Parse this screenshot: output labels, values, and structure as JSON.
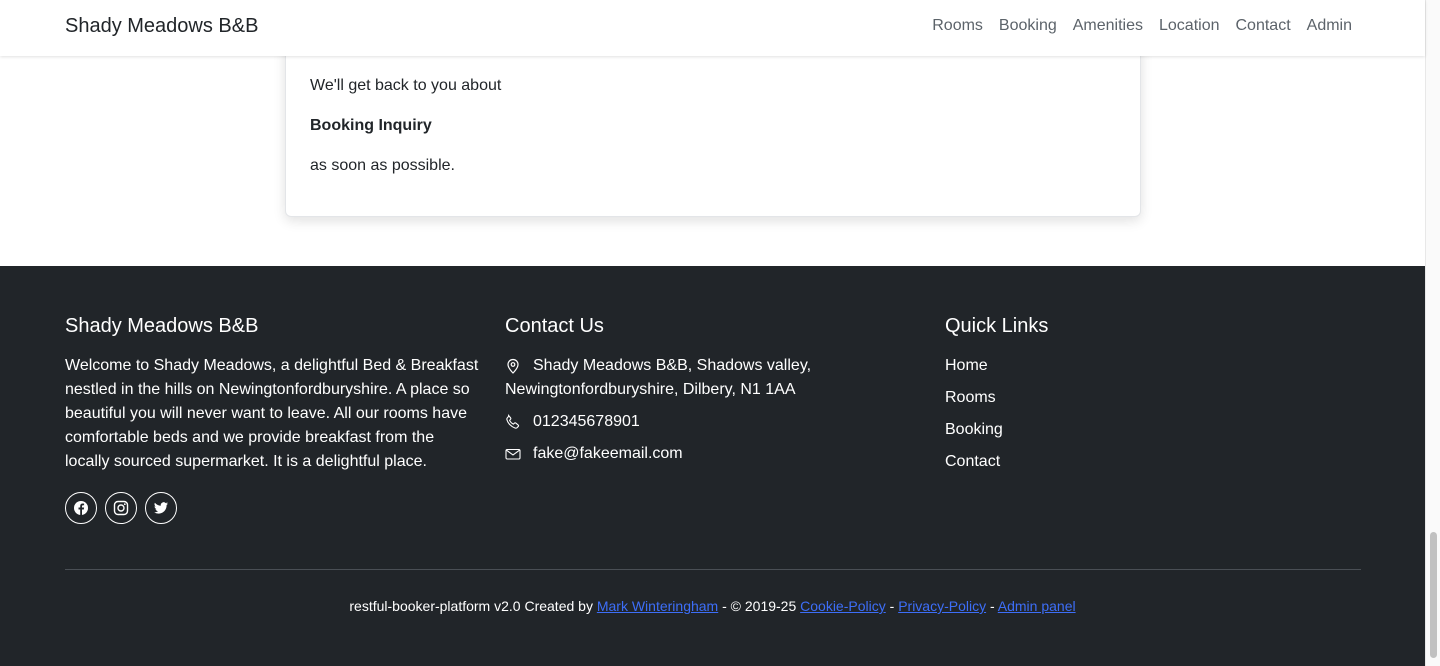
{
  "navbar": {
    "brand": "Shady Meadows B&B",
    "links": [
      "Rooms",
      "Booking",
      "Amenities",
      "Location",
      "Contact",
      "Admin"
    ]
  },
  "card": {
    "line1": "We'll get back to you about",
    "subject": "Booking Inquiry",
    "line3": "as soon as possible."
  },
  "footer": {
    "about": {
      "title": "Shady Meadows B&B",
      "text": "Welcome to Shady Meadows, a delightful Bed & Breakfast nestled in the hills on Newingtonfordburyshire. A place so beautiful you will never want to leave. All our rooms have comfortable beds and we provide breakfast from the locally sourced supermarket. It is a delightful place.",
      "social_icons": [
        "facebook-icon",
        "instagram-icon",
        "twitter-icon"
      ]
    },
    "contact": {
      "title": "Contact Us",
      "address_line1": "Shady Meadows B&B, Shadows valley,",
      "address_line2": "Newingtonfordburyshire, Dilbery, N1 1AA",
      "phone": "012345678901",
      "email": "fake@fakeemail.com"
    },
    "quick_links": {
      "title": "Quick Links",
      "items": [
        "Home",
        "Rooms",
        "Booking",
        "Contact"
      ]
    },
    "copyright": {
      "prefix": "restful-booker-platform v2.0 Created by ",
      "author": "Mark Winteringham",
      "mid": " - © 2019-25 ",
      "cookie": "Cookie-Policy",
      "sep1": " - ",
      "privacy": "Privacy-Policy",
      "sep2": " - ",
      "admin": "Admin panel"
    }
  },
  "colors": {
    "footer_bg": "#212529",
    "link_blue": "#3d6ef8",
    "nav_text": "#5c636a"
  }
}
